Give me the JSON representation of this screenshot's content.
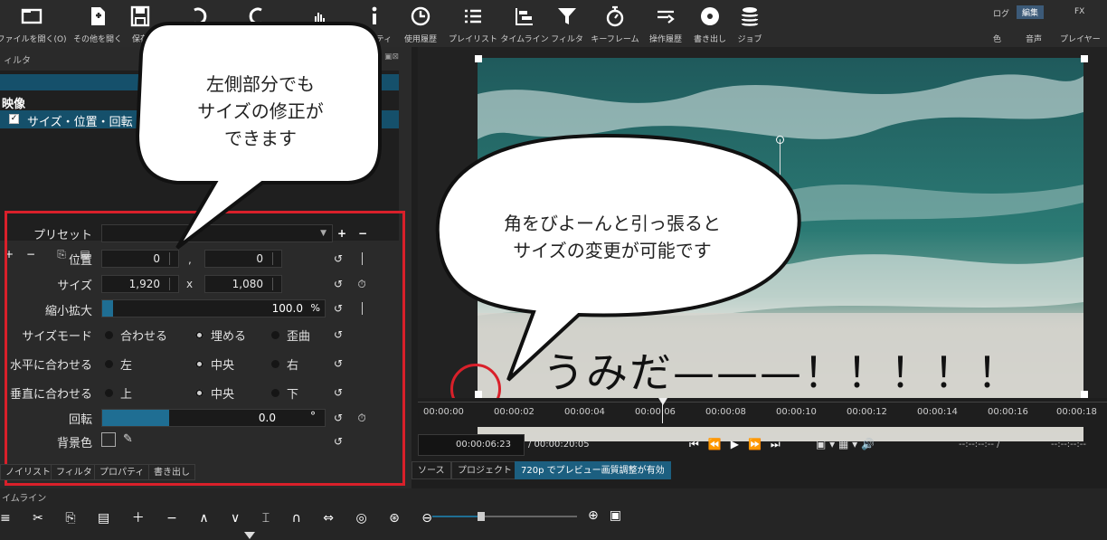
{
  "toolbar": {
    "buttons": [
      {
        "label": "ファイルを開く(O)",
        "icon": "folder-open-icon"
      },
      {
        "label": "その他を開く",
        "icon": "open-other-icon"
      },
      {
        "label": "保存",
        "icon": "save-icon"
      },
      {
        "label": "",
        "icon": "undo-icon"
      },
      {
        "label": "",
        "icon": "redo-icon"
      },
      {
        "label": "",
        "icon": "peak-meter-icon"
      },
      {
        "label": "プロパティ",
        "icon": "info-icon"
      },
      {
        "label": "使用履歴",
        "icon": "clock-icon"
      },
      {
        "label": "プレイリスト",
        "icon": "list-icon"
      },
      {
        "label": "タイムライン",
        "icon": "timeline-icon"
      },
      {
        "label": "フィルタ",
        "icon": "filter-icon"
      },
      {
        "label": "キーフレーム",
        "icon": "stopwatch-icon"
      },
      {
        "label": "操作履歴",
        "icon": "history-icon"
      },
      {
        "label": "書き出し",
        "icon": "export-icon"
      },
      {
        "label": "ジョブ",
        "icon": "jobs-icon"
      }
    ],
    "layout_tabs_top": [
      "ログ",
      "編集",
      "FX"
    ],
    "layout_tabs_bottom": [
      "色",
      "音声",
      "プレイヤー"
    ]
  },
  "filter_panel": {
    "title": "ィルタ",
    "group_label": "映像",
    "filter_name": "サイズ・位置・回転",
    "tool_buttons": [
      "+",
      "−",
      "⎘",
      "▤",
      "^",
      "v",
      "✕"
    ]
  },
  "properties": {
    "preset_label": "プリセット",
    "position_label": "位置",
    "position_x": "0",
    "position_y": "0",
    "position_sep": ",",
    "size_label": "サイズ",
    "size_w": "1,920",
    "size_h": "1,080",
    "size_sep": "x",
    "scale_label": "縮小拡大",
    "scale_value": "100.0",
    "scale_unit": "%",
    "size_mode_label": "サイズモード",
    "size_mode_options": [
      "合わせる",
      "埋める",
      "歪曲"
    ],
    "size_mode_selected": 1,
    "h_align_label": "水平に合わせる",
    "h_align_options": [
      "左",
      "中央",
      "右"
    ],
    "h_align_selected": 1,
    "v_align_label": "垂直に合わせる",
    "v_align_options": [
      "上",
      "中央",
      "下"
    ],
    "v_align_selected": 1,
    "rotation_label": "回転",
    "rotation_value": "0.0",
    "rotation_unit": "°",
    "bg_color_label": "背景色"
  },
  "left_tabs": [
    "ノイリスト",
    "フィルタ",
    "プロパティ",
    "書き出し"
  ],
  "timeline_label": "イムライン",
  "ruler_ticks": [
    "00:00:00",
    "00:00:02",
    "00:00:04",
    "00:00:06",
    "00:00:08",
    "00:00:10",
    "00:00:12",
    "00:00:14",
    "00:00:16",
    "00:00:18"
  ],
  "transport": {
    "current_time": "00:00:06:23",
    "total_time": "/ 00:00:20:05",
    "in_point": "--:--:--:-- /",
    "out_point": "--:--:--:--"
  },
  "preview_tabs": [
    "ソース",
    "プロジェクト",
    "720p でプレビュー画質調整が有効"
  ],
  "callouts": {
    "left_lines": [
      "左側部分でも",
      "サイズの修正が",
      "できます"
    ],
    "right_lines": [
      "角をびよーんと引っ張ると",
      "サイズの変更が可能です"
    ]
  },
  "video_caption": "うみだ———！！！！！",
  "colors": {
    "accent": "#1c5f80",
    "highlight_box": "#d9202a"
  }
}
